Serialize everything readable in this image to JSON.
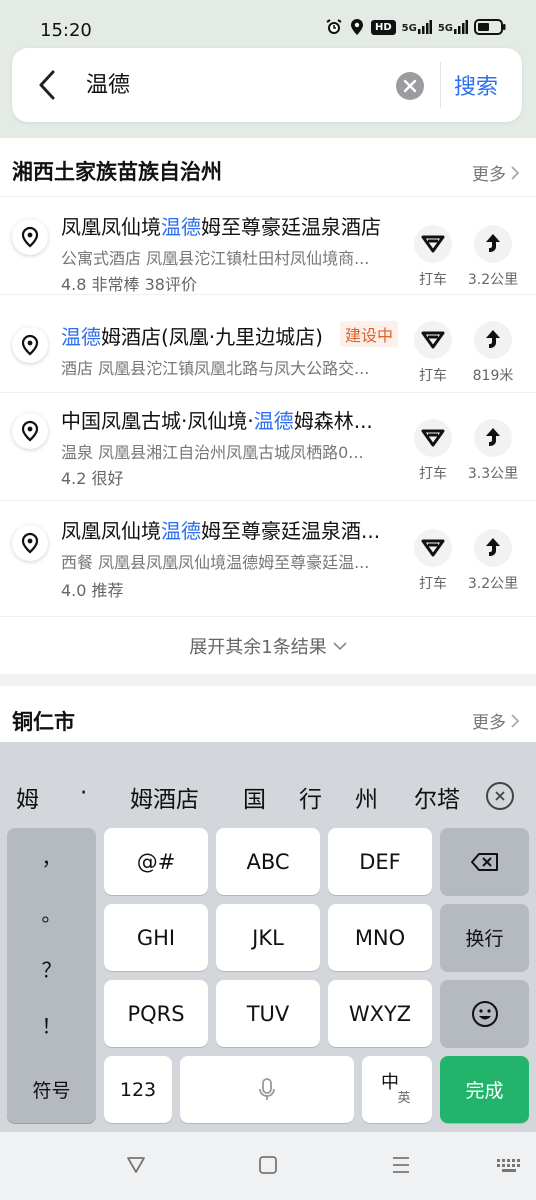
{
  "status_bar": {
    "time": "15:20",
    "net1": "5G",
    "net2": "5G",
    "hd": "HD"
  },
  "search": {
    "query": "温德",
    "search_label": "搜索"
  },
  "section1": {
    "title": "湘西土家族苗族自治州",
    "more_label": "更多",
    "results": [
      {
        "name_parts": [
          "凤凰凤仙境",
          "温德",
          "姆至尊豪廷温泉酒店"
        ],
        "tag": "",
        "desc": "公寓式酒店  凤凰县沱江镇杜田村凤仙境商...",
        "rating": "4.8  非常棒  38评价",
        "taxi_label": "打车",
        "distance": "3.2公里"
      },
      {
        "name_parts": [
          "",
          "温德",
          "姆酒店(凤凰·九里边城店)"
        ],
        "tag": "建设中",
        "desc": "酒店  凤凰县沱江镇凤凰北路与凤大公路交...",
        "rating": "",
        "taxi_label": "打车",
        "distance": "819米"
      },
      {
        "name_parts": [
          "中国凤凰古城·凤仙境·",
          "温德",
          "姆森林..."
        ],
        "tag": "",
        "desc": "温泉  凤凰县湘江自治州凤凰古城凤栖路0...",
        "rating": "4.2  很好",
        "taxi_label": "打车",
        "distance": "3.3公里"
      },
      {
        "name_parts": [
          "凤凰凤仙境",
          "温德",
          "姆至尊豪廷温泉酒..."
        ],
        "tag": "",
        "desc": "西餐  凤凰县凤凰凤仙境温德姆至尊豪廷温...",
        "rating": "4.0  推荐",
        "taxi_label": "打车",
        "distance": "3.2公里"
      }
    ],
    "expand_label": "展开其余1条结果"
  },
  "section2": {
    "title": "铜仁市",
    "more_label": "更多"
  },
  "keyboard": {
    "candidates": [
      "姆",
      "·",
      "姆酒店",
      "国",
      "行",
      "州",
      "尔塔"
    ],
    "punct": [
      "，",
      "。",
      "？",
      "！"
    ],
    "keys": {
      "k_at": "@#",
      "k_abc": "ABC",
      "k_def": "DEF",
      "k_ghi": "GHI",
      "k_jkl": "JKL",
      "k_mno": "MNO",
      "k_newline": "换行",
      "k_pqrs": "PQRS",
      "k_tuv": "TUV",
      "k_wxyz": "WXYZ",
      "k_symbol": "符号",
      "k_123": "123",
      "k_lang_main": "中",
      "k_lang_sub": "英",
      "k_done": "完成"
    }
  },
  "colors": {
    "accent": "#2c6ef2",
    "tag": "#e2602b",
    "done": "#23b46c"
  }
}
